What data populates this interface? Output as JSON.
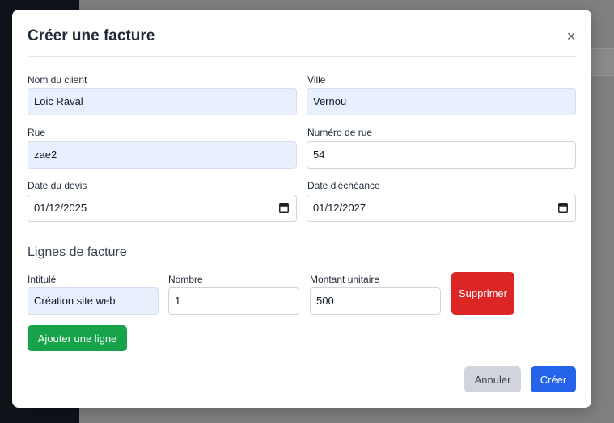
{
  "modal": {
    "title": "Créer une facture",
    "close_symbol": "×"
  },
  "fields": {
    "client_name": {
      "label": "Nom du client",
      "value": "Loic Raval"
    },
    "city": {
      "label": "Ville",
      "value": "Vernou"
    },
    "street": {
      "label": "Rue",
      "value": "zae2"
    },
    "street_number": {
      "label": "Numéro de rue",
      "value": "54"
    },
    "quote_date": {
      "label": "Date du devis",
      "value": "01/12/2025"
    },
    "due_date": {
      "label": "Date d'échéance",
      "value": "01/12/2027"
    }
  },
  "invoice_lines": {
    "title": "Lignes de facture",
    "headers": {
      "label": "Intitulé",
      "quantity": "Nombre",
      "unit_amount": "Montant unitaire"
    },
    "rows": [
      {
        "label": "Création site web",
        "quantity": "1",
        "unit_amount": "500",
        "delete_label": "Supprimer"
      }
    ],
    "add_line_label": "Ajouter une ligne"
  },
  "footer": {
    "cancel_label": "Annuler",
    "create_label": "Créer"
  },
  "icons": {
    "close": "close-icon",
    "calendar": "calendar-icon"
  },
  "colors": {
    "danger": "#dc2626",
    "success": "#16a34a",
    "primary": "#2563eb",
    "autofill": "#e8f0fe"
  }
}
